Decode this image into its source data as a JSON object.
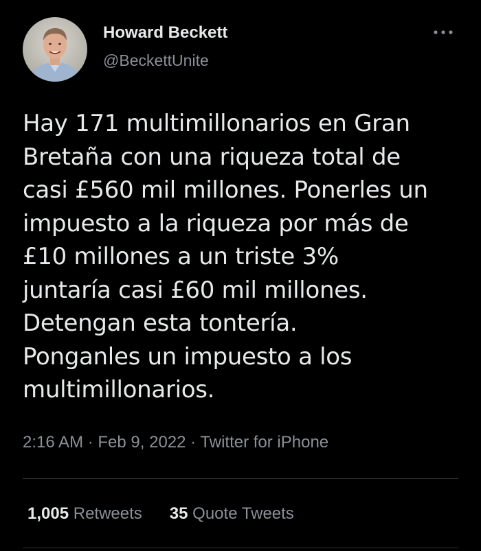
{
  "author": {
    "display_name": "Howard Beckett",
    "handle": "@BeckettUnite",
    "avatar_icon": "profile-photo"
  },
  "more_icon": "more-horizontal-icon",
  "tweet": {
    "text": "Hay 171 multimillonarios en Gran\nBretaña con una riqueza total de\ncasi £560 mil millones. Ponerles un\nimpuesto a la riqueza por más de\n£10 millones a un triste 3%\njuntaría casi £60 mil millones.\nDetengan esta tontería.\nPonganles un impuesto a los\nmultimillonarios."
  },
  "meta": {
    "time": "2:16 AM",
    "separator": " · ",
    "date": "Feb 9, 2022",
    "source": "Twitter for iPhone"
  },
  "stats": {
    "retweets_count": "1,005",
    "retweets_label": "Retweets",
    "quotes_count": "35",
    "quotes_label": "Quote Tweets"
  },
  "colors": {
    "background": "#000000",
    "text": "#e7e9ea",
    "secondary": "#8b9097",
    "divider": "#2f3336"
  }
}
